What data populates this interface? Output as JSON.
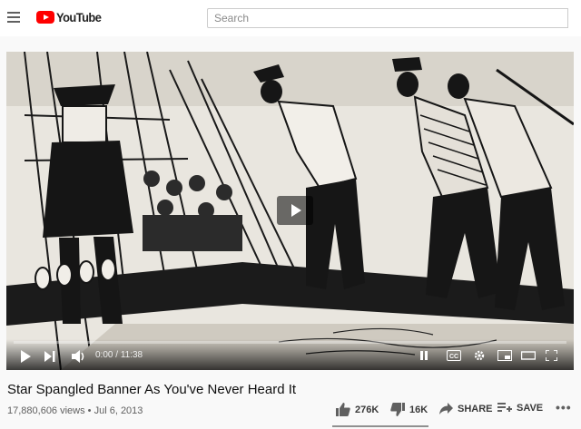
{
  "header": {
    "logo_text": "YouTube",
    "search_placeholder": "Search"
  },
  "player": {
    "time_current": "0:00",
    "time_total": "11:38",
    "time_separator": " / ",
    "progress": 0.0
  },
  "video": {
    "title": "Star Spangled Banner As You've Never Heard It",
    "views": "17,880,606 views",
    "separator": " • ",
    "date": "Jul 6, 2013"
  },
  "actions": {
    "likes": "276K",
    "dislikes": "16K",
    "share_label": "SHARE",
    "save_label": "SAVE"
  },
  "colors": {
    "brand_red": "#ff0000",
    "sentiment_bar": "#909090"
  }
}
